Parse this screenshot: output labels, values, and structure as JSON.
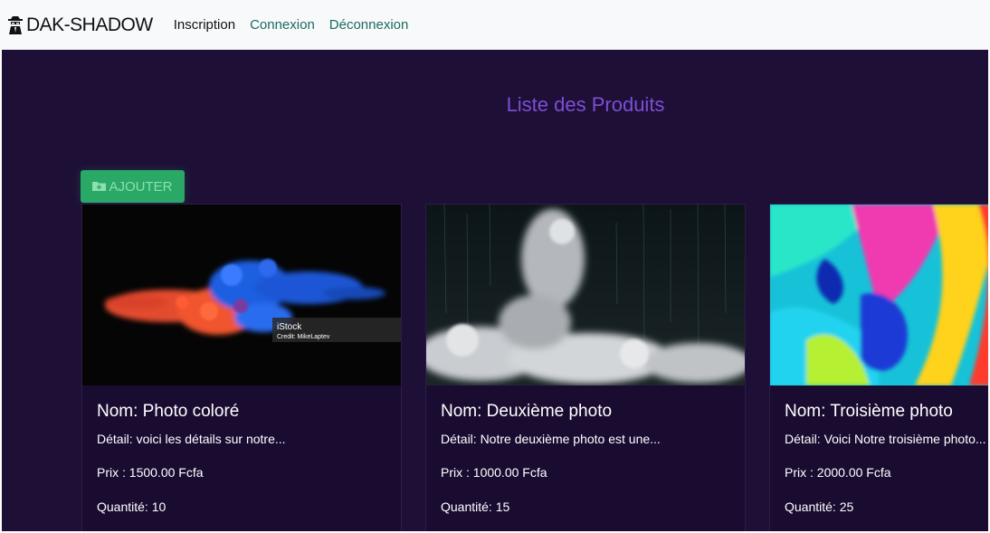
{
  "navbar": {
    "brand": "DAK-SHADOW",
    "brand_icon": "spy-icon",
    "links": [
      {
        "label": "Inscription",
        "active": true
      },
      {
        "label": "Connexion",
        "active": false
      },
      {
        "label": "Déconnexion",
        "active": false
      }
    ]
  },
  "page": {
    "title": "Liste des Produits",
    "add_button_label": "AJOUTER",
    "add_button_icon": "folder-plus-icon"
  },
  "colors": {
    "background": "#1e0f36",
    "title": "#7b4fd6",
    "add_button": "#2aa866",
    "navbar": "#f8f9fa"
  },
  "products": [
    {
      "name": "Nom: Photo coloré",
      "detail": "Détail: voici les détails sur notre...",
      "price": "Prix : 1500.00 Fcfa",
      "quantity": "Quantité: 10",
      "watermark_brand": "iStock",
      "watermark_credit": "Credit: MikeLaptev"
    },
    {
      "name": "Nom: Deuxième photo",
      "detail": "Détail: Notre deuxième photo est une...",
      "price": "Prix : 1000.00 Fcfa",
      "quantity": "Quantité: 15"
    },
    {
      "name": "Nom: Troisième photo",
      "detail": "Détail: Voici Notre troisième photo...",
      "price": "Prix : 2000.00 Fcfa",
      "quantity": "Quantité: 25"
    }
  ]
}
